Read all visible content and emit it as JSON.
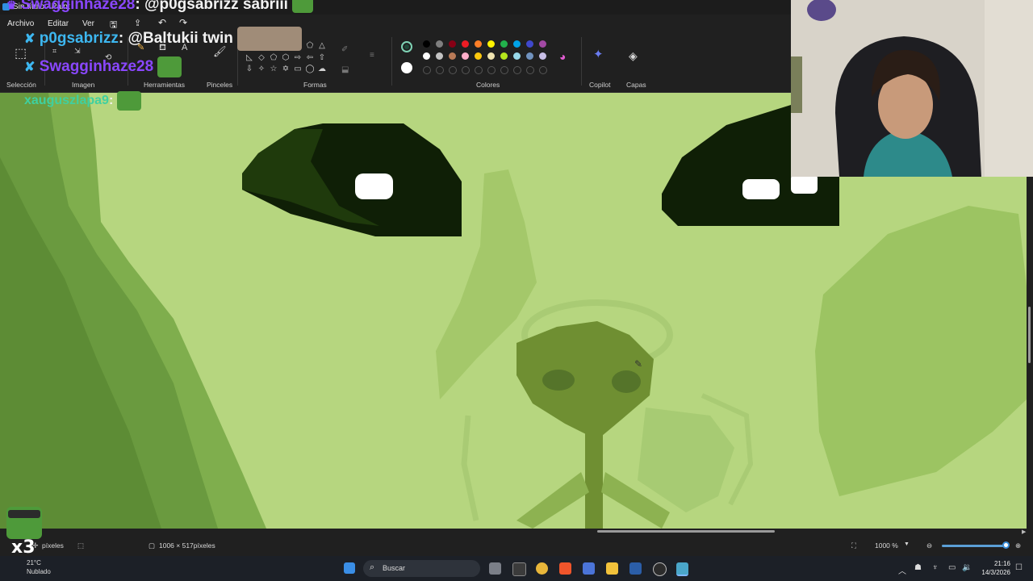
{
  "window": {
    "title": "Sin título - Paint"
  },
  "menu": {
    "items": [
      "Archivo",
      "Editar",
      "Ver"
    ]
  },
  "ribbon": {
    "groups": [
      "Selección",
      "Imagen",
      "Herramientas",
      "Pinceles",
      "Formas",
      "Colores",
      "Copilot",
      "Capas"
    ],
    "palette": [
      "#000000",
      "#7f7f7f",
      "#880015",
      "#ed1c24",
      "#ff7f27",
      "#fff200",
      "#22b14c",
      "#00a2e8",
      "#3f48cc",
      "#a349a4",
      "#ffffff",
      "#c3c3c3",
      "#b97a57",
      "#ffaec9",
      "#ffc90e",
      "#efe4b0",
      "#b5e61d",
      "#99d9ea",
      "#7092be",
      "#c8bfe7"
    ],
    "current_color": "#1f4a3a",
    "secondary_color": "#ffffff"
  },
  "chat": {
    "lines": [
      {
        "user": "Swagginhaze28",
        "message": ": @p0gsabrizz sabriii"
      },
      {
        "user": "p0gsabrizz",
        "message": ": @Baltukii twin"
      },
      {
        "user": "Swagginhaze28",
        "message": ""
      },
      {
        "user": "xauguszlapa9",
        "message": ":"
      }
    ]
  },
  "status": {
    "position": "píxeles",
    "canvas_size": "1006 × 517píxeles",
    "zoom": "1000 %",
    "zoom_level": 1.0
  },
  "taskbar": {
    "search_placeholder": "Buscar",
    "weather_temp": "21°C",
    "weather_text": "Nublado",
    "time": "21:16",
    "date": "14/3/2026"
  },
  "overlay": {
    "multiplier": "x3"
  }
}
